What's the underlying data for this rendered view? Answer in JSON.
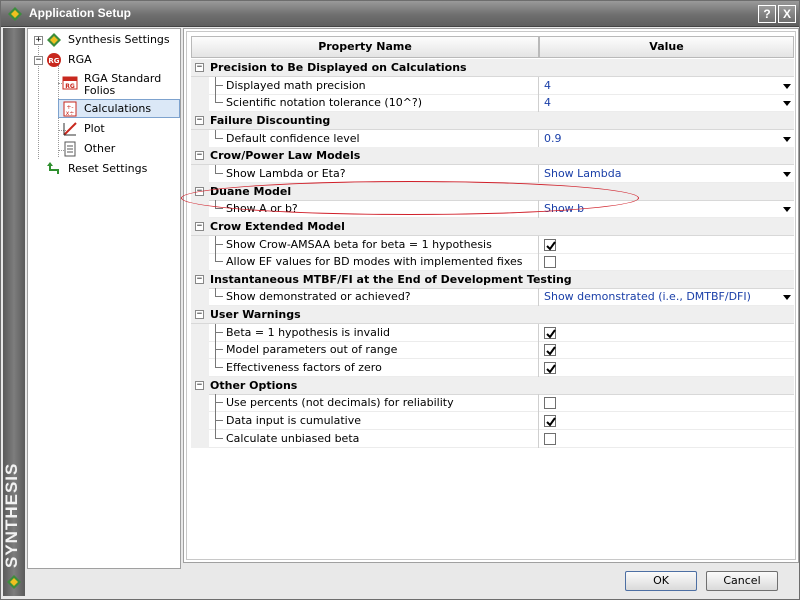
{
  "window": {
    "title": "Application Setup",
    "help_label": "?",
    "close_label": "X"
  },
  "brand": {
    "name": "SYNTHESIS"
  },
  "nav": {
    "synthesis_settings": "Synthesis Settings",
    "rga": "RGA",
    "rga_standard_folios_line1": "RGA Standard",
    "rga_standard_folios_line2": "Folios",
    "calculations": "Calculations",
    "plot": "Plot",
    "other": "Other",
    "reset_settings": "Reset Settings",
    "selected": "calculations"
  },
  "grid": {
    "header_name": "Property Name",
    "header_value": "Value",
    "categories": [
      {
        "label": "Precision to Be Displayed on Calculations",
        "props": [
          {
            "name": "Displayed math precision",
            "type": "select",
            "value": "4"
          },
          {
            "name": "Scientific notation tolerance (10^?)",
            "type": "select",
            "value": "4"
          }
        ]
      },
      {
        "label": "Failure Discounting",
        "props": [
          {
            "name": "Default confidence level",
            "type": "select",
            "value": "0.9"
          }
        ]
      },
      {
        "label": "Crow/Power Law Models",
        "props": [
          {
            "name": "Show Lambda or Eta?",
            "type": "select",
            "value": "Show Lambda"
          }
        ]
      },
      {
        "label": "Duane Model",
        "props": [
          {
            "name": "Show A or b?",
            "type": "select",
            "value": "Show b"
          }
        ]
      },
      {
        "label": "Crow Extended Model",
        "props": [
          {
            "name": "Show Crow-AMSAA beta for beta = 1 hypothesis",
            "type": "checkbox",
            "checked": true
          },
          {
            "name": "Allow EF values for BD modes with implemented fixes",
            "type": "checkbox",
            "checked": false
          }
        ]
      },
      {
        "label": "Instantaneous MTBF/FI at the End of Development Testing",
        "props": [
          {
            "name": "Show demonstrated or achieved?",
            "type": "select",
            "value": "Show demonstrated (i.e., DMTBF/DFI)"
          }
        ]
      },
      {
        "label": "User Warnings",
        "props": [
          {
            "name": "Beta = 1 hypothesis is invalid",
            "type": "checkbox",
            "checked": true
          },
          {
            "name": "Model parameters out of range",
            "type": "checkbox",
            "checked": true
          },
          {
            "name": "Effectiveness factors of zero",
            "type": "checkbox",
            "checked": true
          }
        ]
      },
      {
        "label": "Other Options",
        "props": [
          {
            "name": "Use percents (not decimals) for reliability",
            "type": "checkbox",
            "checked": false
          },
          {
            "name": "Data input is cumulative",
            "type": "checkbox",
            "checked": true
          },
          {
            "name": "Calculate unbiased beta",
            "type": "checkbox",
            "checked": false
          }
        ]
      }
    ]
  },
  "buttons": {
    "ok": "OK",
    "cancel": "Cancel"
  },
  "colors": {
    "value_text": "#1a3fa8",
    "highlight": "#d0202a",
    "selection": "#dbe8f7"
  }
}
